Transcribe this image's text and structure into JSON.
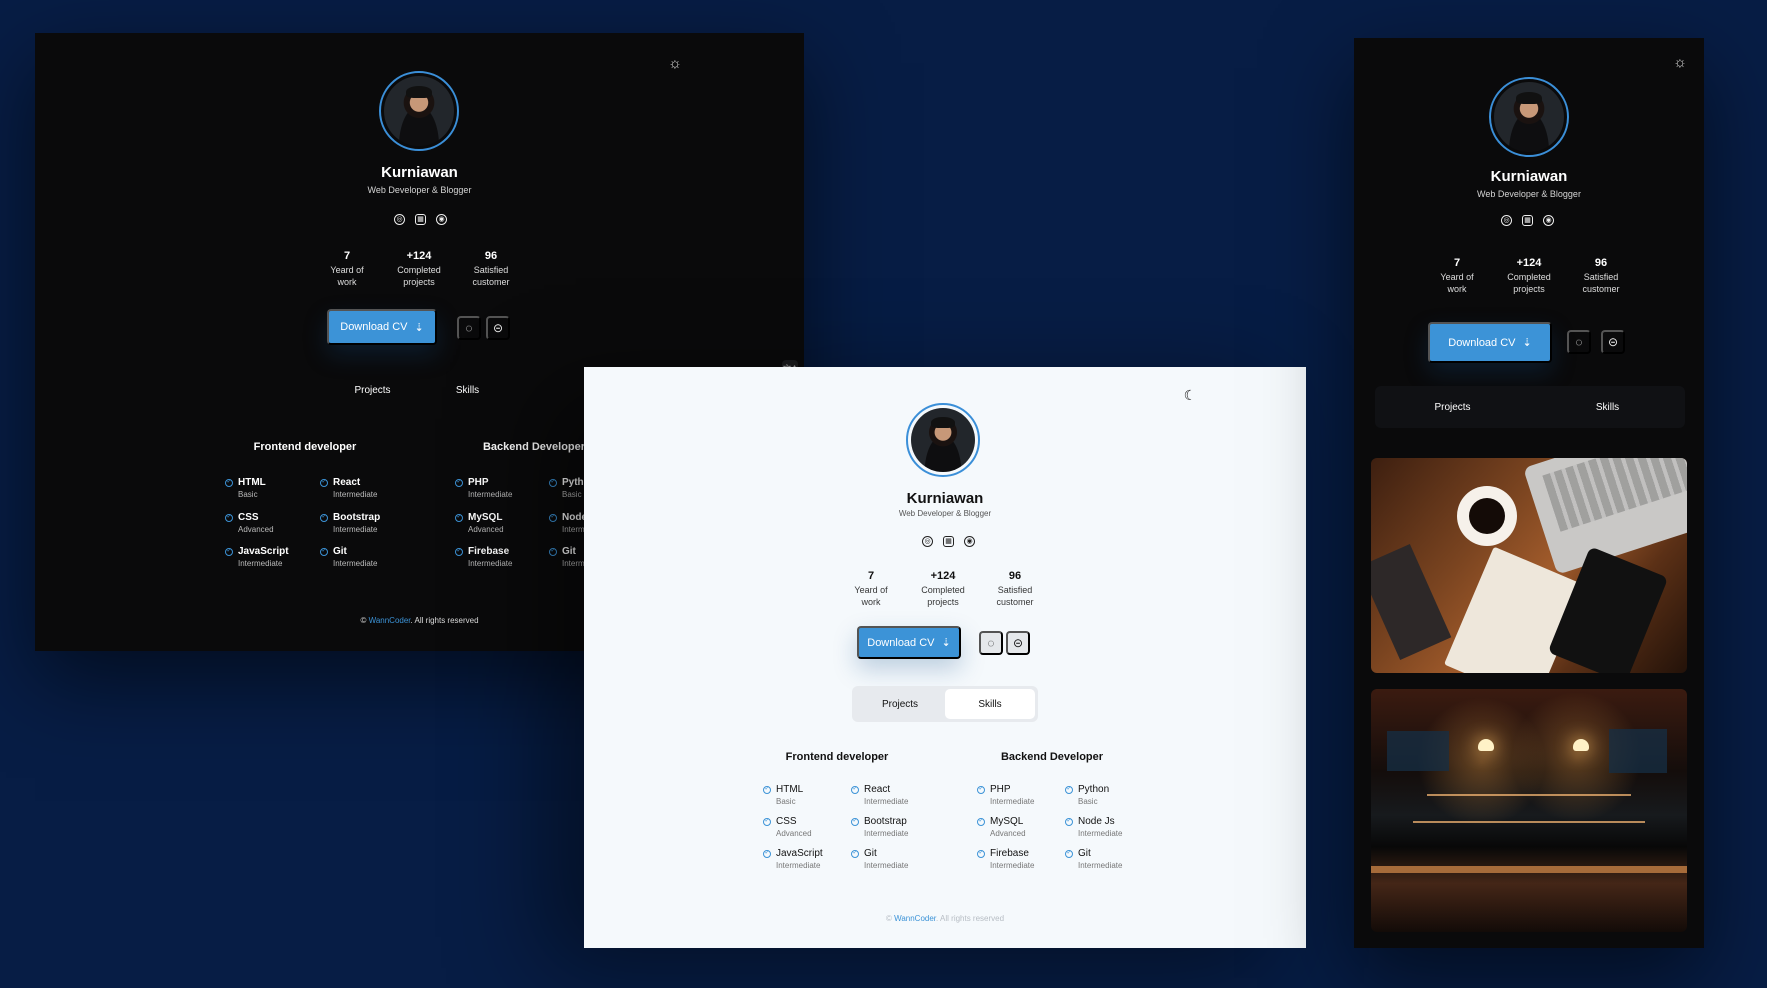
{
  "profile": {
    "name": "Kurniawan",
    "role": "Web Developer & Blogger",
    "social_icons": [
      "instagram-icon",
      "linkedin-icon",
      "github-icon"
    ],
    "stats": [
      {
        "value": "7",
        "label_line1": "Yeard of",
        "label_line2": "work"
      },
      {
        "value": "+124",
        "label_line1": "Completed",
        "label_line2": "projects"
      },
      {
        "value": "96",
        "label_line1": "Satisfied",
        "label_line2": "customer"
      }
    ],
    "download_label": "Download CV",
    "tabs": [
      "Projects",
      "Skills"
    ]
  },
  "skills": {
    "frontend_title": "Frontend developer",
    "backend_title": "Backend Developer",
    "frontend": [
      {
        "name": "HTML",
        "level": "Basic"
      },
      {
        "name": "React",
        "level": "Intermediate"
      },
      {
        "name": "CSS",
        "level": "Advanced"
      },
      {
        "name": "Bootstrap",
        "level": "Intermediate"
      },
      {
        "name": "JavaScript",
        "level": "Intermediate"
      },
      {
        "name": "Git",
        "level": "Intermediate"
      }
    ],
    "backend": [
      {
        "name": "PHP",
        "level": "Intermediate"
      },
      {
        "name": "Python",
        "level": "Basic"
      },
      {
        "name": "MySQL",
        "level": "Advanced"
      },
      {
        "name": "Node Js",
        "level": "Intermediate"
      },
      {
        "name": "Firebase",
        "level": "Intermediate"
      },
      {
        "name": "Git",
        "level": "Intermediate"
      }
    ]
  },
  "footer": {
    "symbol": "©",
    "brand": "WannCoder",
    "rights": ". All rights reserved"
  },
  "icons": {
    "sun": "☼",
    "moon": "☾",
    "whatsapp": "◌",
    "messenger": "⊝",
    "translate": "文A",
    "assistant": "●",
    "download": "⇣"
  },
  "colors": {
    "background": "#071d45",
    "dark_panel": "#0a0a0b",
    "light_panel": "#f5f9fc",
    "accent": "#3c93d7"
  }
}
